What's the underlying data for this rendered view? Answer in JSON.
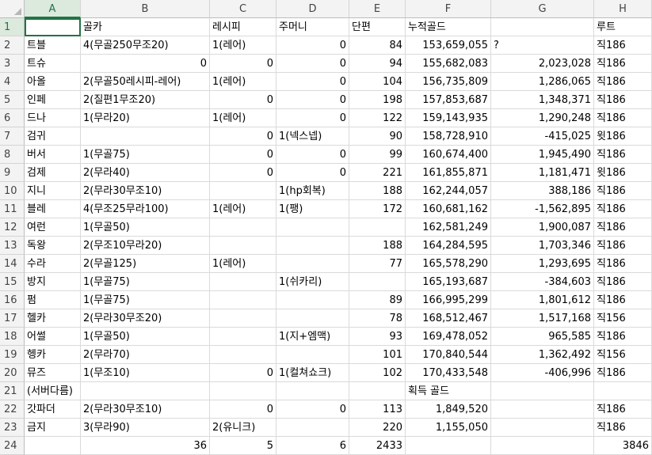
{
  "columns": [
    "A",
    "B",
    "C",
    "D",
    "E",
    "F",
    "G",
    "H"
  ],
  "rows": [
    {
      "num": "1",
      "cells": [
        "",
        "골카",
        "레시피",
        "주머니",
        "단편",
        "누적골드",
        "",
        "루트"
      ]
    },
    {
      "num": "2",
      "cells": [
        "트블",
        "4(무골250무조20)",
        "1(레어)",
        "0",
        "84",
        "153,659,055",
        "?",
        "직186"
      ]
    },
    {
      "num": "3",
      "cells": [
        "트슈",
        "0",
        "0",
        "0",
        "94",
        "155,682,083",
        "2,023,028",
        "직186"
      ]
    },
    {
      "num": "4",
      "cells": [
        "아올",
        "2(무골50레시피-레어)",
        "1(레어)",
        "0",
        "104",
        "156,735,809",
        "1,286,065",
        "직186"
      ]
    },
    {
      "num": "5",
      "cells": [
        "인페",
        "2(질편1무조20)",
        "0",
        "0",
        "198",
        "157,853,687",
        "1,348,371",
        "직186"
      ]
    },
    {
      "num": "6",
      "cells": [
        "드나",
        "1(무라20)",
        "1(레어)",
        "0",
        "122",
        "159,143,935",
        "1,290,248",
        "직186"
      ]
    },
    {
      "num": "7",
      "cells": [
        "검귀",
        "",
        "0",
        "1(넥스넵)",
        "90",
        "158,728,910",
        "-415,025",
        "윗186"
      ]
    },
    {
      "num": "8",
      "cells": [
        "버서",
        "1(무골75)",
        "0",
        "0",
        "99",
        "160,674,400",
        "1,945,490",
        "직186"
      ]
    },
    {
      "num": "9",
      "cells": [
        "검제",
        "2(무라40)",
        "0",
        "0",
        "221",
        "161,855,871",
        "1,181,471",
        "윗186"
      ]
    },
    {
      "num": "10",
      "cells": [
        "지니",
        "2(무라30무조10)",
        "",
        "1(hp회복)",
        "188",
        "162,244,057",
        "388,186",
        "직186"
      ]
    },
    {
      "num": "11",
      "cells": [
        "블레",
        "4(무조25무라100)",
        "1(레어)",
        "1(팽)",
        "172",
        "160,681,162",
        "-1,562,895",
        "직186"
      ]
    },
    {
      "num": "12",
      "cells": [
        "여런",
        "1(무골50)",
        "",
        "",
        "",
        "162,581,249",
        "1,900,087",
        "직186"
      ]
    },
    {
      "num": "13",
      "cells": [
        "독왕",
        "2(무조10무라20)",
        "",
        "",
        "188",
        "164,284,595",
        "1,703,346",
        "직186"
      ]
    },
    {
      "num": "14",
      "cells": [
        "수라",
        "2(무골125)",
        "1(레어)",
        "",
        "77",
        "165,578,290",
        "1,293,695",
        "직186"
      ]
    },
    {
      "num": "15",
      "cells": [
        "방지",
        "1(무골75)",
        "",
        "1(쉬카리)",
        "",
        "165,193,687",
        "-384,603",
        "직186"
      ]
    },
    {
      "num": "16",
      "cells": [
        "펌",
        "1(무골75)",
        "",
        "",
        "89",
        "166,995,299",
        "1,801,612",
        "직186"
      ]
    },
    {
      "num": "17",
      "cells": [
        "헬카",
        "2(무라30무조20)",
        "",
        "",
        "78",
        "168,512,467",
        "1,517,168",
        "직156"
      ]
    },
    {
      "num": "18",
      "cells": [
        "어썰",
        "1(무골50)",
        "",
        "1(지+엠맥)",
        "93",
        "169,478,052",
        "965,585",
        "직186"
      ]
    },
    {
      "num": "19",
      "cells": [
        "헹카",
        "2(무라70)",
        "",
        "",
        "101",
        "170,840,544",
        "1,362,492",
        "직156"
      ]
    },
    {
      "num": "20",
      "cells": [
        "뮤즈",
        "1(무조10)",
        "0",
        "1(컬쳐쇼크)",
        "102",
        "170,433,548",
        "-406,996",
        "직186"
      ]
    },
    {
      "num": "21",
      "cells": [
        "(서버다름)",
        "",
        "",
        "",
        "",
        "획득 골드",
        "",
        ""
      ]
    },
    {
      "num": "22",
      "cells": [
        "갓파더",
        "2(무라30무조10)",
        "0",
        "0",
        "113",
        "1,849,520",
        "",
        "직186"
      ]
    },
    {
      "num": "23",
      "cells": [
        "금지",
        "3(무라90)",
        "2(유니크)",
        "",
        "220",
        "1,155,050",
        "",
        "직186"
      ]
    },
    {
      "num": "24",
      "cells": [
        "",
        "36",
        "5",
        "6",
        "2433",
        "",
        "",
        "3846"
      ]
    }
  ]
}
